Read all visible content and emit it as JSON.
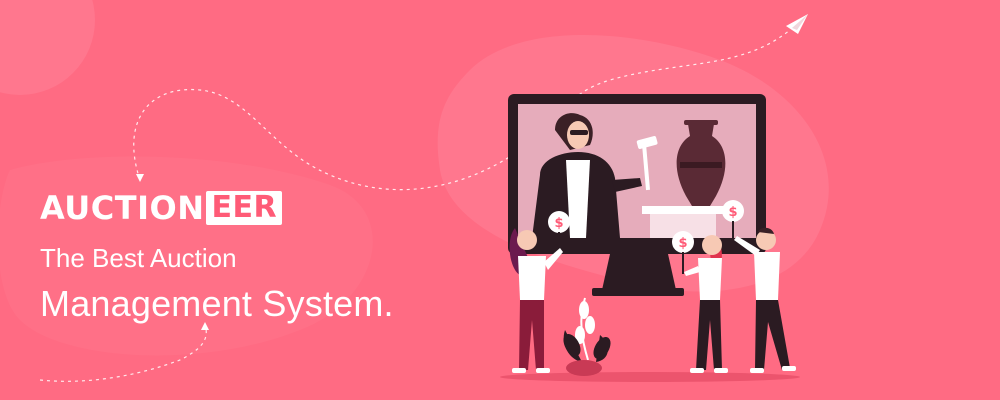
{
  "brand": {
    "name_main": "AUCTION",
    "name_highlight": "EER"
  },
  "tagline": {
    "line1": "The Best Auction",
    "line2": "Management System."
  },
  "illustration": {
    "bid_sign_symbol": "$"
  },
  "colors": {
    "background": "#ff6b83",
    "accent": "#ff5b77",
    "dark": "#2b1b22"
  }
}
